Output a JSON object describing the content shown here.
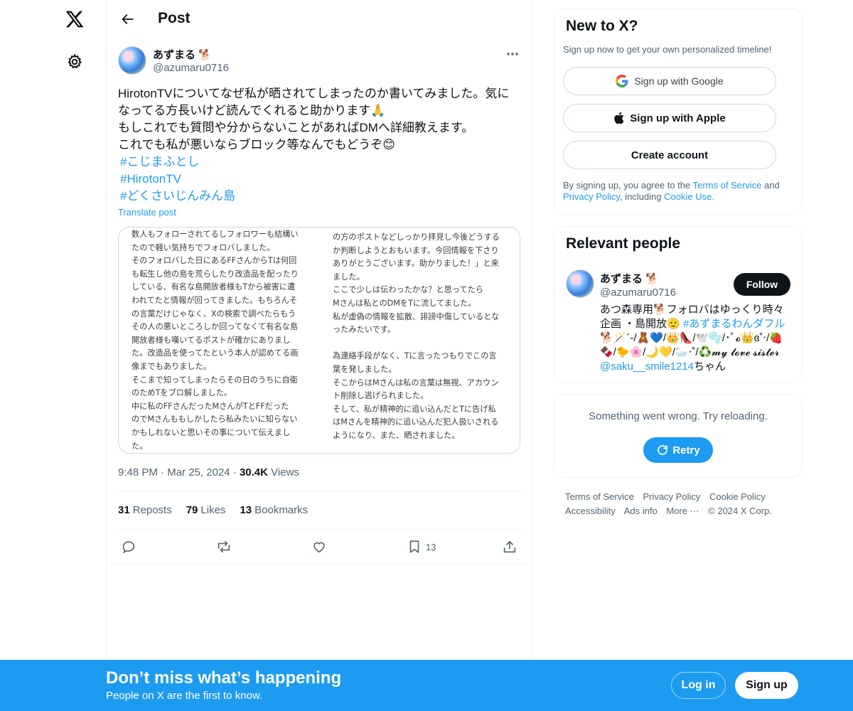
{
  "nav": {
    "logo_icon": "x-logo-icon",
    "settings_icon": "gear-icon"
  },
  "header": {
    "title": "Post",
    "back_icon": "arrow-left-icon"
  },
  "post": {
    "author_name": "あずまる 🐕",
    "author_handle": "@azumaru0716",
    "text": "HirotonTVについてなぜ私が晒されてしまったのか書いてみました。気に\nなってる方長いけど読んでくれると助かります🙏\nもしこれでも質問や分からないことがあればDMへ詳細教えます。\nこれでも私が悪いならブロック等なんでもどうぞ😊",
    "hashtags": [
      "#こじまふとし",
      "#HirotonTV",
      "#どくさいじんみん島"
    ],
    "translate": "Translate post",
    "image_text_left": "数人もフォローされてるしフォロワーも結構い\nたので軽い気持ちでフォロバしました。\nそのフォロバした日にあるFFさんからTは何回\nも転生し他の島を荒らしたり改造品を配ったり\nしている、有名な島開放者様もTから被害に遭\nわれてたと情報が回ってきました。もちろんそ\nの言葉だけじゃなく、Xの検索で調べたらもう\nその人の悪いところしか回ってなくて有名な島\n開放者様も嘆いてるポストが確かにありまし\nた。改造品を使ってたという本人が認めてる画\n像までもありました。\nそこまで知ってしまったらその日のうちに自衛\nのためTをブロ解しました。\n中に私のFFさんだったMさんがTとFFだった\nのでMさんももしかしたら私みたいに知らない\nかもしれないと思いその事について伝えまし\nた。",
    "image_text_right": "の方のポストなどしっかり拝見し今後どうする\nか判断しようとおもいます。今回情報を下さり\nありがとうございます。助かりました！」と来\nました。\nここで少しは伝わったかな？と思ってたら\nMさんは私とのDMをTに流してました。\n私が虚偽の情報を拡散、誹謗中傷しているとな\nったみたいです。\n\n為連絡手段がなく、Tに言ったつもりでこの言\n葉を発しました。\nそこからはMさんは私の言葉は無視、アカウン\nト削除し逃げられました。\nそして、私が精神的に追い込んだとTに告げ私\nはMさんを精神的に追い込んだ犯人扱いされる\nようになり、また、晒されました。",
    "time": "9:48 PM",
    "date": "Mar 25, 2024",
    "views_count": "30.4K",
    "views_label": "Views",
    "reposts_count": "31",
    "reposts_label": "Reposts",
    "likes_count": "79",
    "likes_label": "Likes",
    "bookmarks_count": "13",
    "bookmarks_label": "Bookmarks",
    "bookmark_action_count": "13"
  },
  "signup_card": {
    "title": "New to X?",
    "subtitle": "Sign up now to get your own personalized timeline!",
    "google": "Sign up with Google",
    "apple": "Sign up with Apple",
    "create": "Create account",
    "terms_prefix": "By signing up, you agree to the ",
    "terms_link": "Terms of Service",
    "terms_and": " and",
    "privacy_link": "Privacy Policy",
    "terms_including": ", including ",
    "cookie_link": "Cookie Use."
  },
  "relevant": {
    "title": "Relevant people",
    "name": "あずまる 🐕",
    "handle": "@azumaru0716",
    "follow": "Follow",
    "bio_1": "あつ森専用🐕フォロバはゆっくり時々企画 ・島開放🫡 ",
    "bio_tag": "#あずまるわんダフル",
    "bio_2": " 🐕🪄´-/🧸💙/👑👠/🕊️🫧/･ﾟ𝓸👑ɞ˚‧/🍓🍫/🐤🌸/🌙💛/🦢‧˚/♻️𝓶𝔂 𝓵𝓸𝓿𝓮 𝓼𝓲𝓼𝓽𝓮𝓻 ",
    "bio_mention": "@saku__smile1214",
    "bio_3": "ちゃん"
  },
  "error_card": {
    "message": "Something went wrong. Try reloading.",
    "retry": "Retry"
  },
  "footer": [
    "Terms of Service",
    "Privacy Policy",
    "Cookie Policy",
    "Accessibility",
    "Ads info",
    "More ···",
    "© 2024 X Corp."
  ],
  "banner": {
    "title": "Don’t miss what’s happening",
    "subtitle": "People on X are the first to know.",
    "login": "Log in",
    "signup": "Sign up"
  },
  "colors": {
    "accent": "#1d9bf0",
    "text": "#0f1419",
    "muted": "#536471",
    "border": "#eff3f4"
  }
}
